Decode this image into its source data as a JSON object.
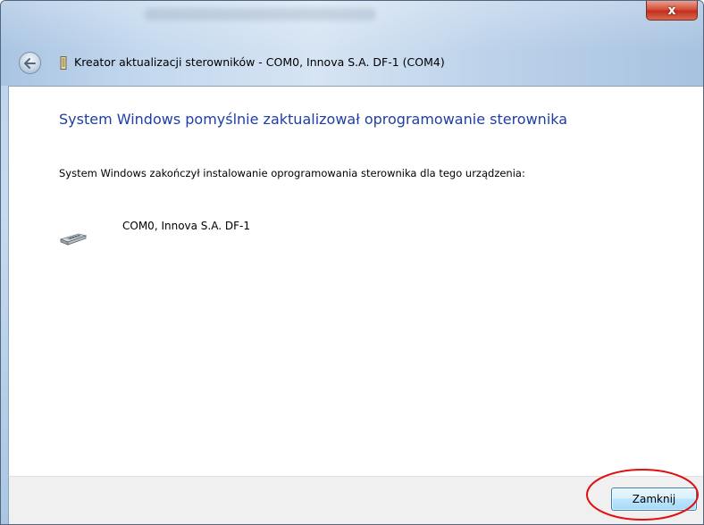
{
  "window": {
    "title": "Kreator aktualizacji sterowników - COM0, Innova S.A. DF-1 (COM4)",
    "close_glyph": "x",
    "back_icon": "back-arrow-icon",
    "wizard_icon": "wizard-icon"
  },
  "content": {
    "heading": "System Windows pomyślnie zaktualizował oprogramowanie sterownika",
    "description": "System Windows zakończył instalowanie oprogramowania sterownika dla tego urządzenia:",
    "device": {
      "icon": "serial-port-icon",
      "name": "COM0, Innova S.A. DF-1"
    }
  },
  "footer": {
    "close_button_label": "Zamknij"
  },
  "colors": {
    "heading": "#1e3ea6",
    "annotation": "#e01010",
    "close_button": "#c1301c"
  }
}
